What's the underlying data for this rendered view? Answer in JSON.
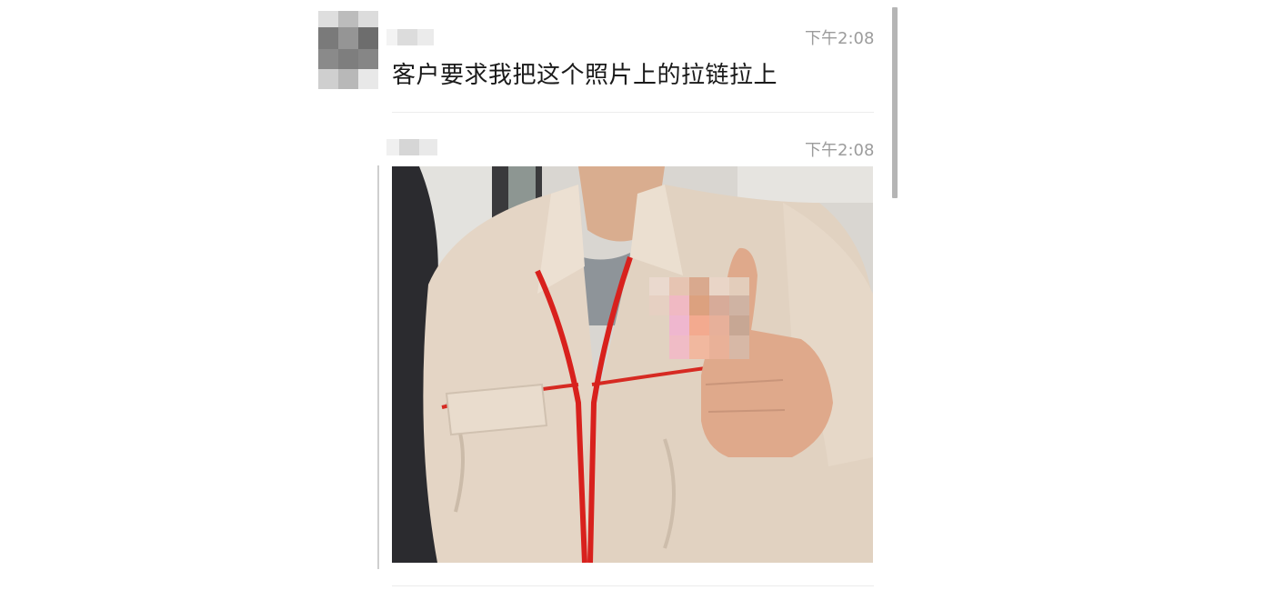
{
  "messages": [
    {
      "time": "下午2:08",
      "text": "客户要求我把这个照片上的拉链拉上"
    },
    {
      "time": "下午2:08",
      "image": {
        "kind": "photo",
        "subject": "jacket-thumbs-up"
      }
    }
  ],
  "colors": {
    "timestamp": "#9c9c9c",
    "text": "#1a1a1a",
    "jacket": "#e5d6c6",
    "zipper": "#d8211d",
    "scrollbar": "#b5b5b5"
  }
}
